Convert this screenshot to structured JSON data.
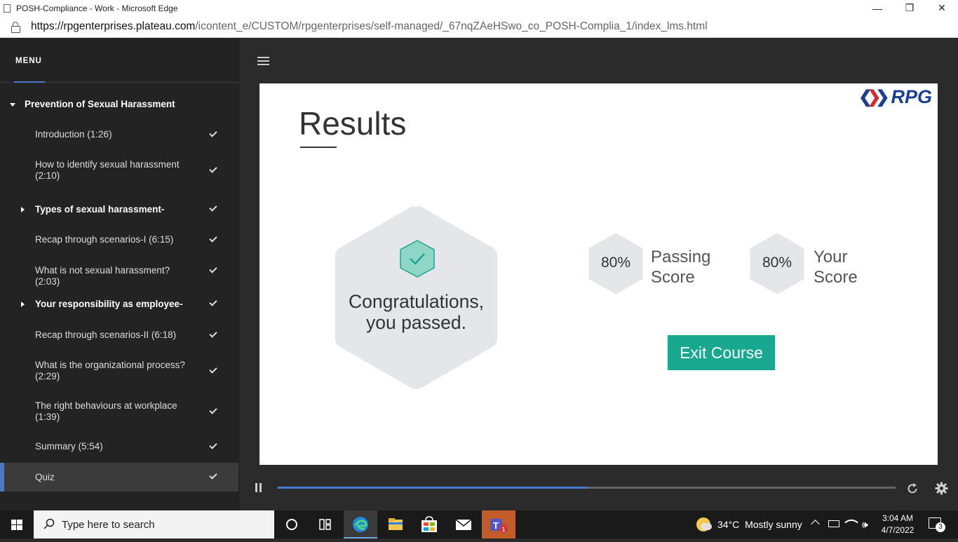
{
  "window": {
    "title": "POSH-Compliance - Work - Microsoft Edge",
    "minimize": "—",
    "restore": "❐",
    "close": "✕"
  },
  "address": {
    "host": "https://rpgenterprises.plateau.com",
    "path": "/icontent_e/CUSTOM/rpgenterprises/self-managed/_67nqZAeHSwo_co_POSH-Complia_1/index_lms.html"
  },
  "sidebar": {
    "menu_label": "MENU",
    "section_title": "Prevention of Sexual Harassment",
    "items": [
      {
        "label": "Introduction (1:26)"
      },
      {
        "label": "How to identify sexual harassment (2:10)"
      },
      {
        "label": "Types of sexual harassment-"
      },
      {
        "label": "Recap through scenarios-I (6:15)"
      },
      {
        "label": "What is not sexual harassment? (2:03)"
      },
      {
        "label": "Your responsibility as employee-"
      },
      {
        "label": "Recap through scenarios-II (6:18)"
      },
      {
        "label": "What is the organizational process? (2:29)"
      },
      {
        "label": "The right behaviours at workplace (1:39)"
      },
      {
        "label": "Summary (5:54)"
      },
      {
        "label": "Quiz"
      }
    ]
  },
  "slide": {
    "logo_text": "RPG",
    "title": "Results",
    "congrats": "Congratulations, you passed.",
    "passing_value": "80%",
    "passing_label": "Passing Score",
    "your_value": "80%",
    "your_label": "Your Score",
    "exit_label": "Exit Course"
  },
  "player": {
    "progress": 0.5
  },
  "taskbar": {
    "search_placeholder": "Type here to search",
    "weather_temp": "34°C",
    "weather_text": "Mostly sunny",
    "time": "3:04 AM",
    "date": "4/7/2022",
    "notifications": "3",
    "teams_badge": "1"
  },
  "colors": {
    "accent": "#4a79c9",
    "exit_button": "#17a88f",
    "hex_fill": "#e4e6ea"
  }
}
